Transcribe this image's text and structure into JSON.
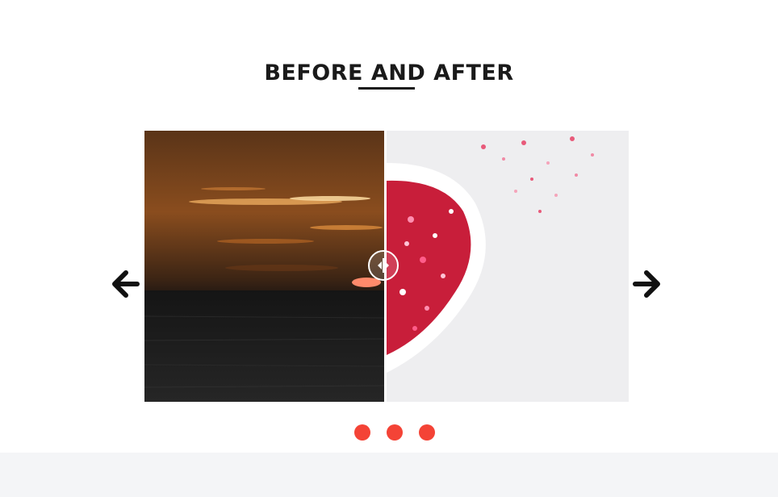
{
  "heading": {
    "title": "BEFORE AND AFTER"
  },
  "comparison": {
    "before_image": "sunset-over-sea",
    "after_image": "heart-bowl-of-sprinkles",
    "slider_position": 0.5
  },
  "navigation": {
    "prev_icon": "arrow-left-icon",
    "next_icon": "arrow-right-icon"
  },
  "pagination": {
    "dot_count": 3,
    "active_index": 0
  },
  "colors": {
    "text": "#1a1a1a",
    "accent": "#f44336",
    "footer_background": "#f4f5f7",
    "handle": "#ffffff"
  }
}
